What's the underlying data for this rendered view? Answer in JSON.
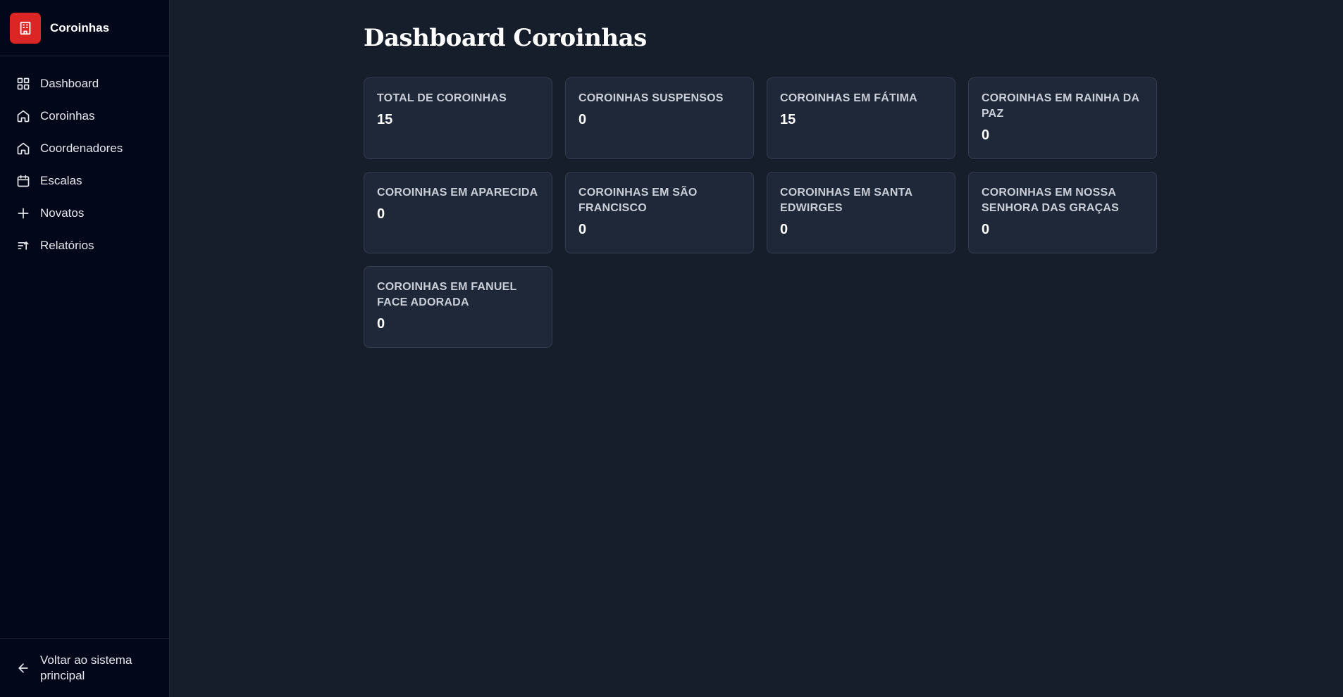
{
  "sidebar": {
    "brand": {
      "name": "Coroinhas",
      "color": "#dc2626",
      "icon": "building-icon"
    },
    "items": [
      {
        "label": "Dashboard",
        "icon": "grid-icon"
      },
      {
        "label": "Coroinhas",
        "icon": "home-icon"
      },
      {
        "label": "Coordenadores",
        "icon": "home-icon"
      },
      {
        "label": "Escalas",
        "icon": "calendar-icon"
      },
      {
        "label": "Novatos",
        "icon": "plus-icon"
      },
      {
        "label": "Relatórios",
        "icon": "list-filter-icon"
      }
    ],
    "footer": {
      "label": "Voltar ao sistema principal",
      "icon": "arrow-left-icon"
    }
  },
  "main": {
    "title": "Dashboard Coroinhas",
    "cards": [
      {
        "label": "Total de Coroinhas",
        "value": "15"
      },
      {
        "label": "Coroinhas Suspensos",
        "value": "0"
      },
      {
        "label": "Coroinhas em Fátima",
        "value": "15"
      },
      {
        "label": "Coroinhas em Rainha da Paz",
        "value": "0"
      },
      {
        "label": "Coroinhas em Aparecida",
        "value": "0"
      },
      {
        "label": "Coroinhas em São Francisco",
        "value": "0"
      },
      {
        "label": "Coroinhas em Santa Edwirges",
        "value": "0"
      },
      {
        "label": "Coroinhas em Nossa Senhora das Graças",
        "value": "0"
      },
      {
        "label": "Coroinhas em Fanuel Face Adorada",
        "value": "0"
      }
    ]
  }
}
